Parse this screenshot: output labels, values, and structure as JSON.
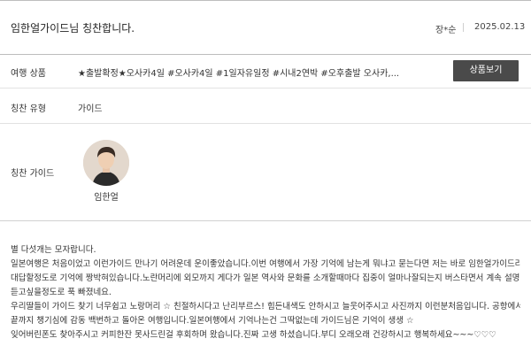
{
  "header": {
    "title": "임한얼가이드님 칭찬합니다.",
    "author": "장*순",
    "date": "2025.02.13"
  },
  "rows": {
    "product_label": "여행 상품",
    "product_value": "★출발확정★오사카4일 #오사카4일 #1일자유일정 #시내2연박 #오후출발 오사카,...",
    "product_button": "상품보기",
    "type_label": "칭찬 유형",
    "type_value": "가이드",
    "guide_label": "칭찬 가이드",
    "guide_name": "임한얼"
  },
  "review": {
    "lines": [
      "별 다섯개는 모자랍니다.",
      "일본여행은 처음이었고 이런가이드 만나기 어려운데 운이좋았습니다.이번 여행에서 가장 기억에 남는게 뭐냐고 묻는다면 저는 바로 임한얼가이드라고",
      "대답할정도로 기억에 짱박혀있습니다.노란머리에 외모까지 게다가 일본 역사와 문화를 소개할때마다 집중이 얼마나잘되는지 버스타면서 계속 설명만",
      "듣고싶을정도로 푹 빠졌네요.",
      "우리딸들이 가이드 찾기 너무쉽고 노랑머리 ☆ 친절하시다고 난리부르스! 힘든내색도 안하시고 늘웃어주시고 사진까지 이런분처음입니다. 공항에서도",
      "끝까지 챙기심에 감동 백번하고 돌아온 여행입니다.일본여행에서 기억나는건 그딱없는데 가이드님은 기억이 생생 ☆",
      "잊어버린폰도 찾아주시고 커피한잔 못사드린걸 후회하며 왔습니다.진짜 고생 하셨습니다.부디 오래오래 건강하시고 행복하세요~~~♡♡♡"
    ]
  }
}
